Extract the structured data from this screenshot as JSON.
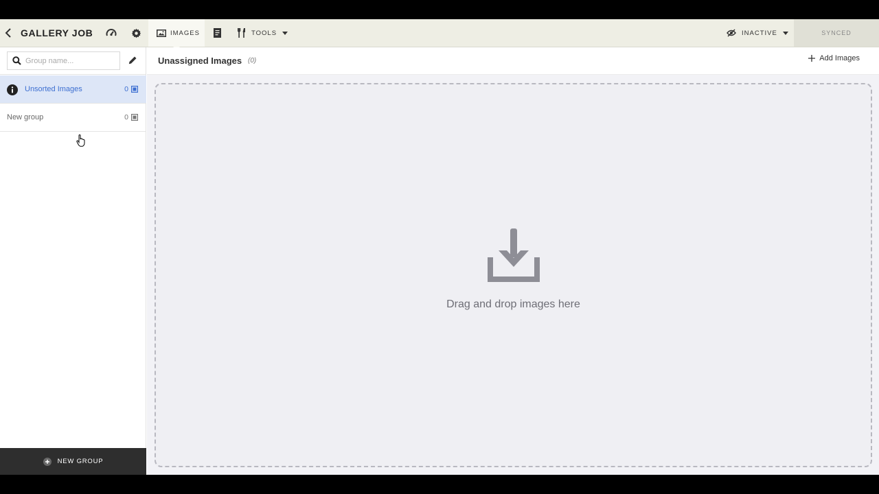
{
  "topbar": {
    "title": "GALLERY JOB",
    "tabs": {
      "images": "IMAGES",
      "tools": "TOOLS"
    },
    "status": "INACTIVE",
    "sync": "SYNCED",
    "icons": [
      "chevron-left-icon",
      "dashboard-icon",
      "gear-icon",
      "image-icon",
      "document-icon",
      "tools-icon",
      "caret-down-icon",
      "eye-off-icon"
    ]
  },
  "sidebar": {
    "search_placeholder": "Group name...",
    "groups": [
      {
        "label": "Unsorted Images",
        "count": "0",
        "active": true
      },
      {
        "label": "New group",
        "count": "0",
        "active": false
      }
    ],
    "new_group_label": "NEW GROUP"
  },
  "main": {
    "title": "Unassigned Images",
    "count": "(0)",
    "add_label": "Add Images",
    "drop_text": "Drag and drop images here"
  },
  "colors": {
    "topbar_bg": "#eeeee4",
    "active_group_bg": "#dde6f7",
    "active_group_text": "#3d6fd1",
    "new_group_bg": "#2e2e2e",
    "dropzone_bg": "#efeff3"
  }
}
